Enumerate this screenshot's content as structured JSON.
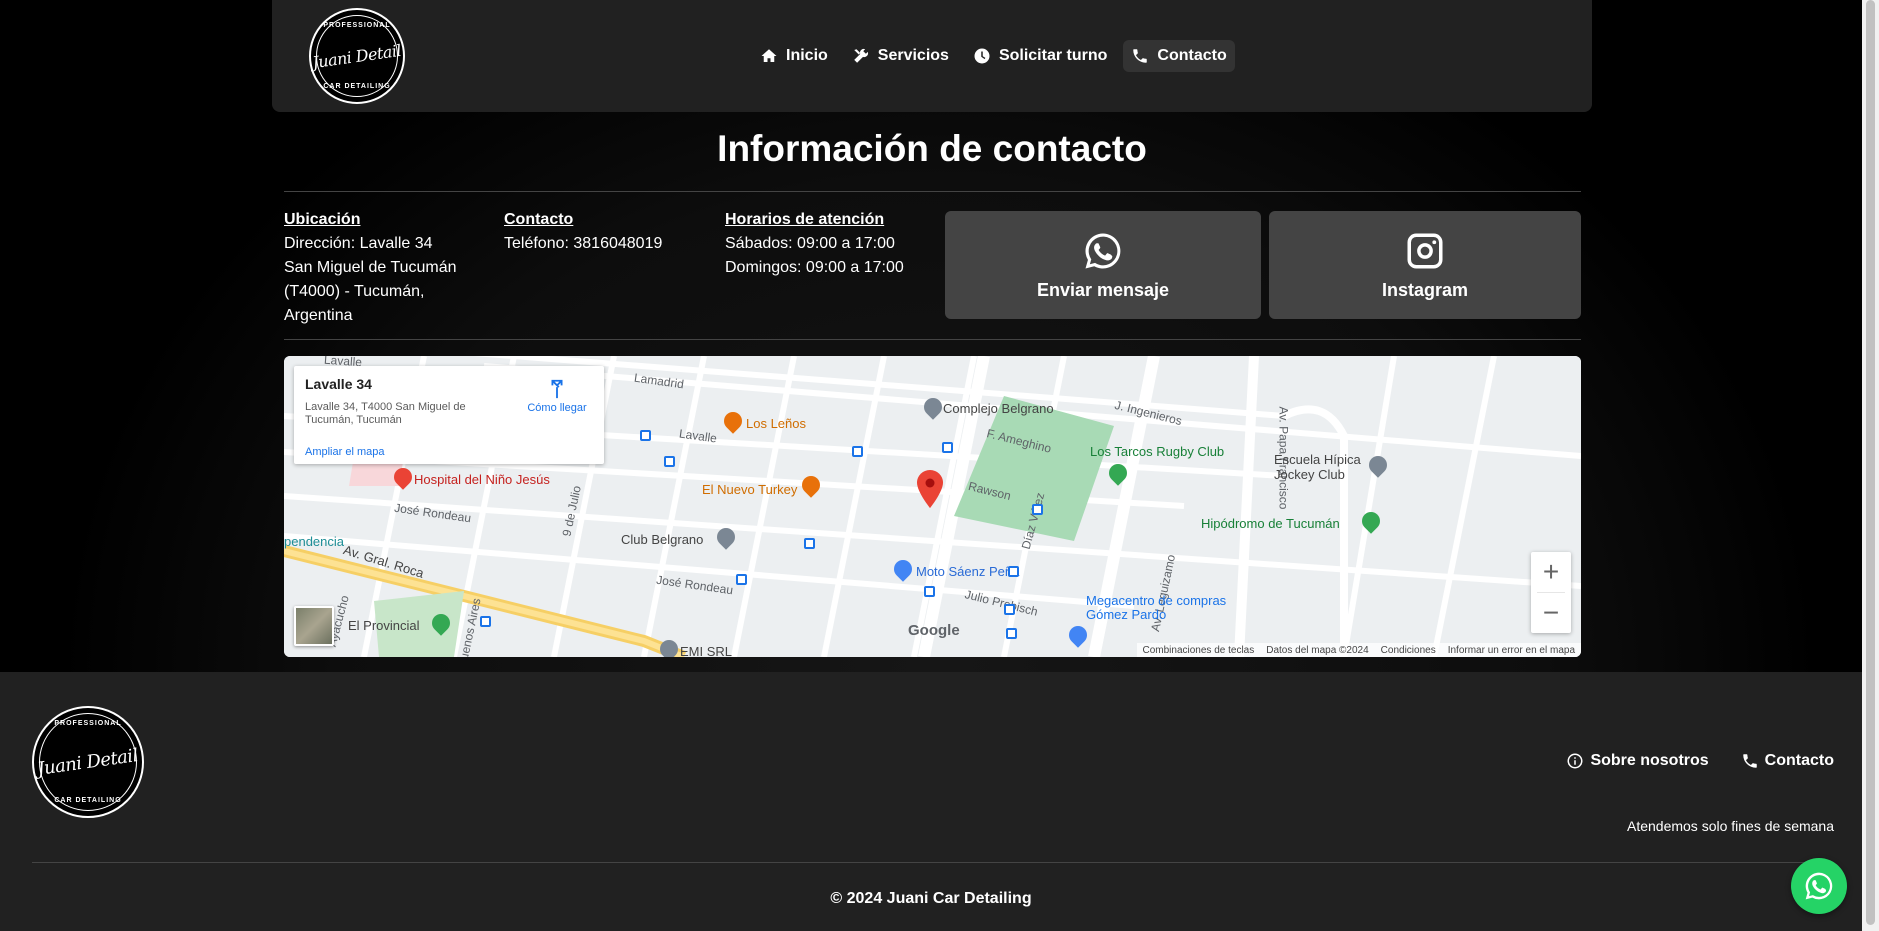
{
  "header": {
    "logo": {
      "top_text": "PROFESSIONAL",
      "script_text": "Juani Detail",
      "bottom_text": "CAR DETAILING"
    },
    "nav": [
      {
        "label": "Inicio",
        "icon": "home-icon"
      },
      {
        "label": "Servicios",
        "icon": "tools-icon"
      },
      {
        "label": "Solicitar turno",
        "icon": "clock-icon"
      },
      {
        "label": "Contacto",
        "icon": "phone-icon",
        "active": true
      }
    ]
  },
  "main": {
    "title": "Información de contacto",
    "location": {
      "heading": "Ubicación",
      "lines": [
        "Dirección: Lavalle 34",
        "San Miguel de Tucumán",
        "(T4000) - Tucumán,",
        "Argentina"
      ]
    },
    "contact": {
      "heading": "Contacto",
      "phone": "Teléfono: 3816048019"
    },
    "hours": {
      "heading": "Horarios de atención",
      "saturday": "Sábados: 09:00 a 17:00",
      "sunday": "Domingos: 09:00 a 17:00"
    },
    "buttons": {
      "whatsapp": "Enviar mensaje",
      "instagram": "Instagram"
    }
  },
  "map": {
    "card": {
      "name": "Lavalle 34",
      "address": "Lavalle 34, T4000 San Miguel de Tucumán, Tucumán",
      "directions": "Cómo llegar",
      "enlarge": "Ampliar el mapa"
    },
    "labels": {
      "los_lenos": "Los Leños",
      "nuevo_turkey": "El Nuevo Turkey",
      "hospital": "Hospital del Niño Jesús",
      "club_belgrano": "Club Belgrano",
      "complejo_belgrano": "Complejo Belgrano",
      "los_tarcos": "Los Tarcos Rugby Club",
      "escuela_hipica": "Escuela Hípica Jockey Club",
      "hipodromo": "Hipódromo de Tucumán",
      "moto_saenz": "Moto Sáenz Peña",
      "megacentro": "Megacentro de compras Gómez Pardo",
      "el_provincial": "El Provincial",
      "emi_srl": "EMI SRL",
      "independencia": "pendencia",
      "lamadrid": "Lamadrid",
      "lavalle_st": "Lavalle",
      "lavalle_top": "Lavalle",
      "rawson": "Rawson",
      "ameghino": "F. Ameghino",
      "ingenieros": "J. Ingenieros",
      "jose_rondeau": "José Rondeau",
      "jose_rondeau_2": "José Rondeau",
      "av_roca": "Av. Gral. Roca",
      "julio_prebisch": "Julio Prebisch",
      "diaz_velez": "Díaz Vélez",
      "papa_francisco": "Av. Papa Francisco",
      "leguizamo": "Av. Leguizamo",
      "nueve_julio": "9 de Julio",
      "ayacucho": "Ayacucho",
      "buenos_aires": "Buenos Aires",
      "google": "Google"
    },
    "attribution": [
      "Combinaciones de teclas",
      "Datos del mapa ©2024",
      "Condiciones",
      "Informar un error en el mapa"
    ]
  },
  "footer": {
    "links": [
      {
        "label": "Sobre nosotros",
        "icon": "info-icon"
      },
      {
        "label": "Contacto",
        "icon": "phone-icon"
      }
    ],
    "note": "Atendemos solo fines de semana",
    "copyright": "© 2024 Juani Car Detailing"
  },
  "colors": {
    "whatsapp_green": "#25d366",
    "pin_red": "#ea4335",
    "park_green": "#a8dab5"
  }
}
